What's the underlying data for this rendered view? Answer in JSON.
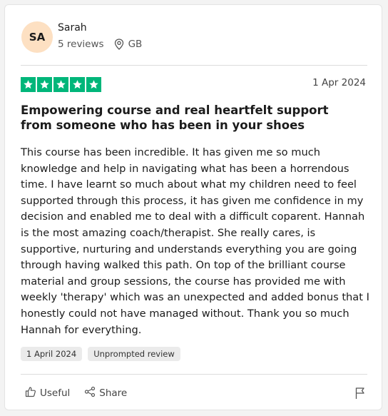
{
  "reviewer": {
    "initials": "SA",
    "name": "Sarah",
    "reviews_count": "5 reviews",
    "location": "GB"
  },
  "review": {
    "rating": 5,
    "date": "1 Apr 2024",
    "title": "Empowering course and real heartfelt support from someone who has been in your shoes",
    "body": "This course has been incredible. It has given me so much knowledge and help in navigating what has been a horrendous time. I have learnt so much about what my children need to feel supported through this process, it has given me confidence in my decision and enabled me to deal with a difficult coparent. Hannah is the most amazing coach/therapist. She really cares, is supportive, nurturing and understands everything you are going through having walked this path. On top of the brilliant course material and group sessions, the course has provided me with weekly 'therapy' which was an unexpected and added bonus that I honestly could not have managed without. Thank you so much Hannah for everything.",
    "tags": [
      "1 April 2024",
      "Unprompted review"
    ]
  },
  "actions": {
    "useful_label": "Useful",
    "share_label": "Share"
  },
  "colors": {
    "star_green": "#00b67a",
    "avatar_bg": "#fde0c2"
  },
  "icons": [
    "location-pin-icon",
    "star-icon",
    "thumbs-up-icon",
    "share-icon",
    "flag-icon"
  ]
}
